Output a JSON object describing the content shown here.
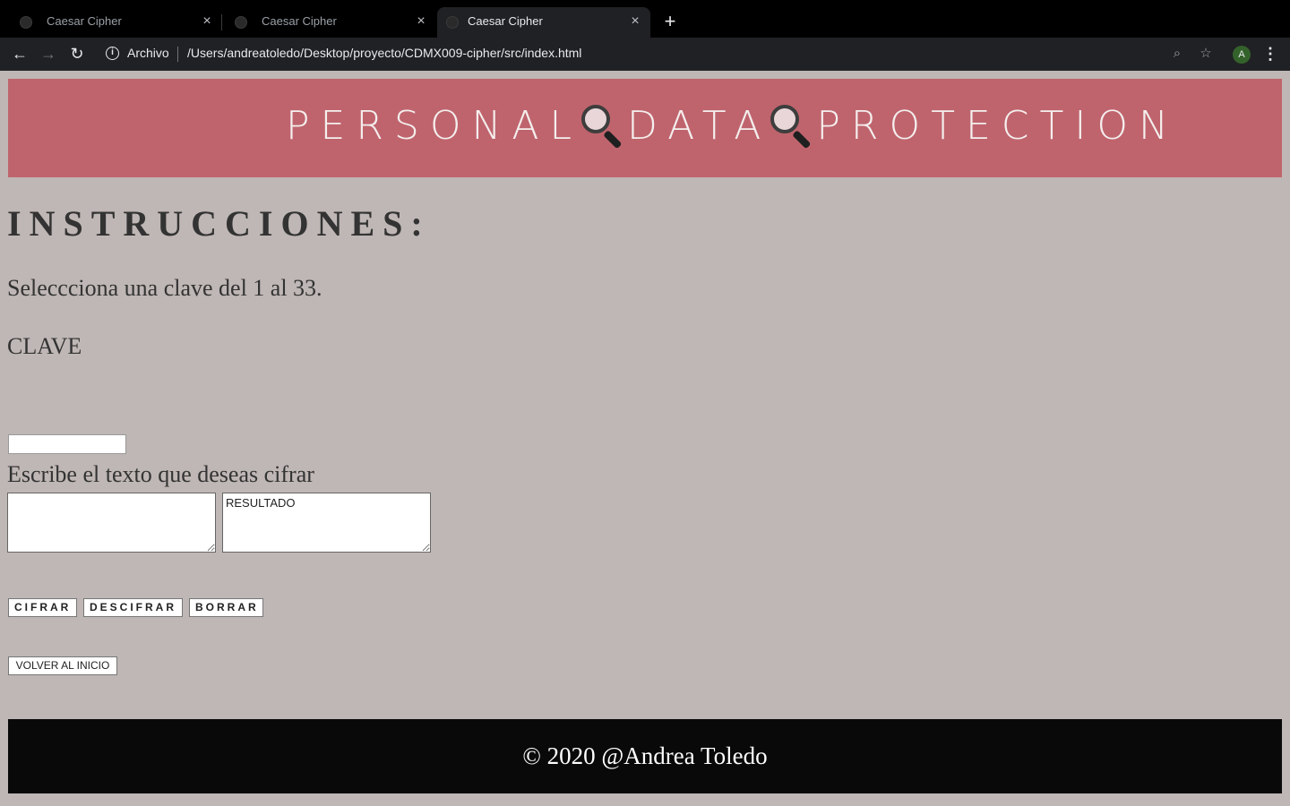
{
  "browser": {
    "tabs": [
      {
        "title": "Caesar Cipher",
        "close": "×",
        "active": false
      },
      {
        "title": "Caesar Cipher",
        "close": "×",
        "active": false
      },
      {
        "title": "Caesar Cipher",
        "close": "×",
        "active": true
      }
    ],
    "new_tab": "+",
    "back": "←",
    "forward": "→",
    "reload": "↻",
    "info_icon": "i",
    "address_label": "Archivo",
    "url": "/Users/andreatoledo/Desktop/proyecto/CDMX009-cipher/src/index.html",
    "zoom_icon": "⌕",
    "star_icon": "☆",
    "avatar": "A",
    "menu": "⋮",
    "chrome_color": "#202124"
  },
  "banner": {
    "word1": "PERSONAL",
    "word2": "DATA",
    "word3": "PROTECTION",
    "icon": "magnifying-glass-icon",
    "color": "#bf646d"
  },
  "main": {
    "heading": "INSTRUCCIONES:",
    "instruction": "Seleccciona una clave del 1 al 33.",
    "key_label": "CLAVE",
    "key_value": "",
    "text_label": "Escribe el texto que deseas cifrar",
    "input_text": "",
    "result_text": "RESULTADO",
    "buttons": {
      "cipher": "CIFRAR",
      "decipher": "DESCIFRAR",
      "clear": "BORRAR",
      "home": "VOLVER AL INICIO"
    },
    "background": "#bfb7b5"
  },
  "footer": {
    "text": "© 2020 @Andrea Toledo",
    "color": "#090909"
  }
}
